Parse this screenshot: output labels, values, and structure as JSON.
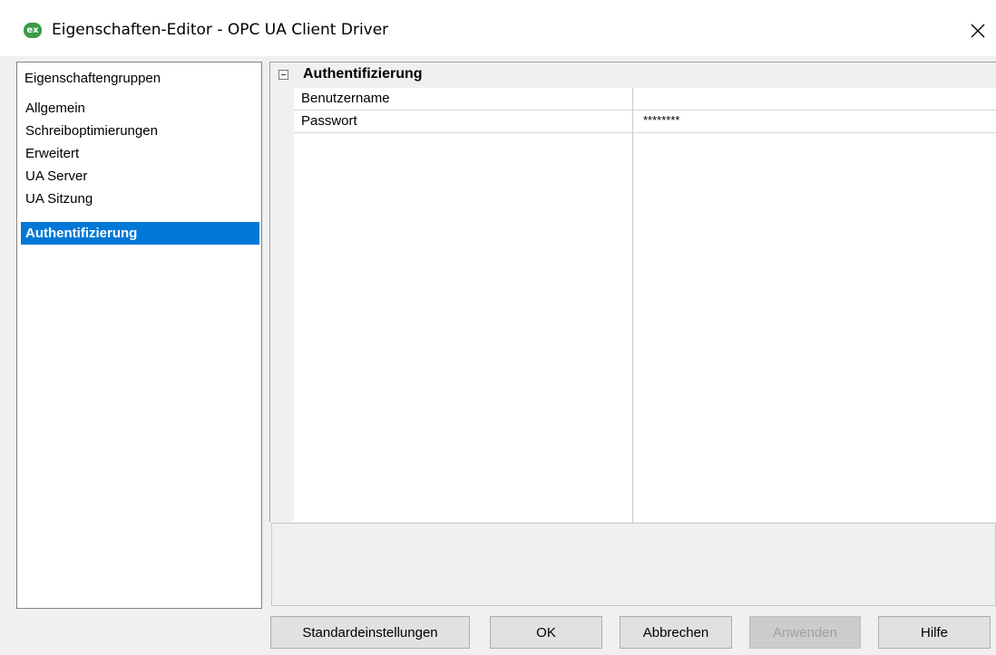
{
  "window": {
    "title": "Eigenschaften-Editor - OPC UA Client Driver",
    "app_icon_text": "ex"
  },
  "groups": {
    "header": "Eigenschaftengruppen",
    "items": [
      {
        "label": "Allgemein"
      },
      {
        "label": "Schreiboptimierungen"
      },
      {
        "label": "Erweitert"
      },
      {
        "label": "UA Server"
      },
      {
        "label": "UA Sitzung"
      },
      {
        "label": "Authentifizierung",
        "selected": true
      }
    ]
  },
  "grid": {
    "category": "Authentifizierung",
    "properties": [
      {
        "name": "Benutzername",
        "value": ""
      },
      {
        "name": "Passwort",
        "value": "********"
      }
    ]
  },
  "buttons": {
    "defaults": "Standardeinstellungen",
    "ok": "OK",
    "cancel": "Abbrechen",
    "apply": "Anwenden",
    "help": "Hilfe"
  },
  "colors": {
    "selection": "#0078d7",
    "app_icon": "#3c9a4a"
  }
}
